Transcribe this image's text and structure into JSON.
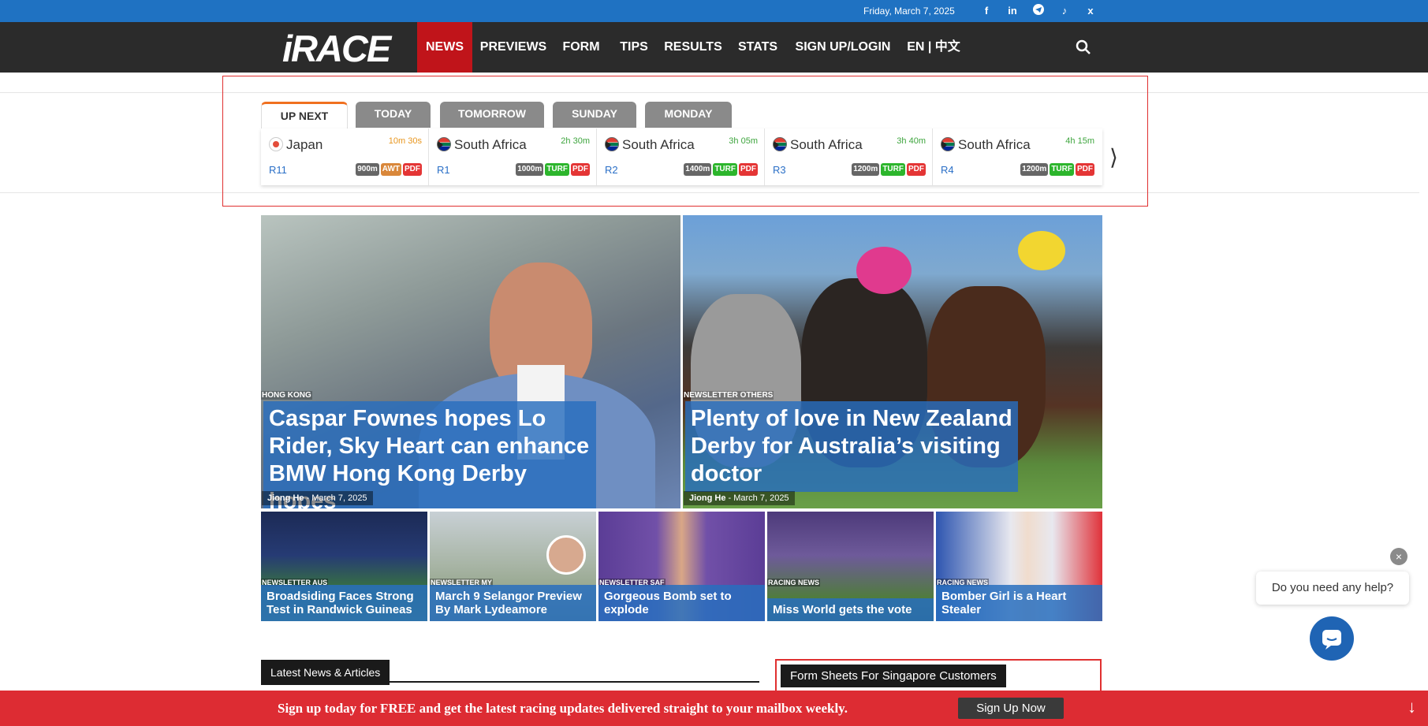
{
  "topbar": {
    "date": "Friday, March 7, 2025",
    "social_icons": [
      "facebook-icon",
      "linkedin-icon",
      "telegram-icon",
      "tiktok-icon",
      "x-icon"
    ]
  },
  "nav": {
    "logo": "iRACE",
    "logo_mark": "®",
    "items": [
      "NEWS",
      "PREVIEWS",
      "FORM",
      "TIPS",
      "RESULTS",
      "STATS",
      "SIGN UP/LOGIN",
      "EN | 中文"
    ],
    "active": "NEWS"
  },
  "race_tabs": [
    "UP NEXT",
    "TODAY",
    "TOMORROW",
    "SUNDAY",
    "MONDAY"
  ],
  "races": [
    {
      "country": "Japan",
      "flag": "jp",
      "time": "10m 30s",
      "time_color": "#e8961e",
      "race": "R11",
      "distance": "900m",
      "surface": "AWT",
      "pdf": "PDF"
    },
    {
      "country": "South Africa",
      "flag": "za",
      "time": "2h 30m",
      "time_color": "#3ea53e",
      "race": "R1",
      "distance": "1000m",
      "surface": "TURF",
      "pdf": "PDF"
    },
    {
      "country": "South Africa",
      "flag": "za",
      "time": "3h 05m",
      "time_color": "#3ea53e",
      "race": "R2",
      "distance": "1400m",
      "surface": "TURF",
      "pdf": "PDF"
    },
    {
      "country": "South Africa",
      "flag": "za",
      "time": "3h 40m",
      "time_color": "#3ea53e",
      "race": "R3",
      "distance": "1200m",
      "surface": "TURF",
      "pdf": "PDF"
    },
    {
      "country": "South Africa",
      "flag": "za",
      "time": "4h 15m",
      "time_color": "#3ea53e",
      "race": "R4",
      "distance": "1200m",
      "surface": "TURF",
      "pdf": "PDF"
    }
  ],
  "featured": [
    {
      "category": "HONG KONG",
      "title": "Caspar Fownes hopes Lo Rider, Sky Heart can enhance BMW Hong Kong Derby hopes",
      "author": "Jiong He",
      "date": "March 7, 2025"
    },
    {
      "category": "NEWSLETTER OTHERS",
      "title": "Plenty of love in New Zealand Derby for Australia’s visiting doctor",
      "author": "Jiong He",
      "date": "March 7, 2025"
    }
  ],
  "small_articles": [
    {
      "category": "NEWSLETTER AUS",
      "title": "Broadsiding Faces Strong Test in Randwick Guineas"
    },
    {
      "category": "NEWSLETTER MY",
      "title": "March 9 Selangor Preview By Mark Lydeamore"
    },
    {
      "category": "NEWSLETTER SAF",
      "title": "Gorgeous Bomb set to explode"
    },
    {
      "category": "RACING NEWS",
      "title": "Miss World gets the vote"
    },
    {
      "category": "RACING NEWS",
      "title": "Bomber Girl is a Heart Stealer"
    }
  ],
  "sections": {
    "latest": "Latest News & Articles",
    "form_sheets": "Form Sheets For Singapore Customers"
  },
  "chat": {
    "help_text": "Do you need any help?",
    "close": "×"
  },
  "signup": {
    "text": "Sign up today for FREE and get the latest racing updates delivered straight to your mailbox weekly.",
    "button": "Sign Up Now",
    "arrow": "↓"
  },
  "colors": {
    "topbar": "#1f72c2",
    "navbar": "#2b2b2b",
    "nav_active": "#c0141a",
    "accent_blue": "#286ebe",
    "signup_bar": "#dd2c33"
  }
}
